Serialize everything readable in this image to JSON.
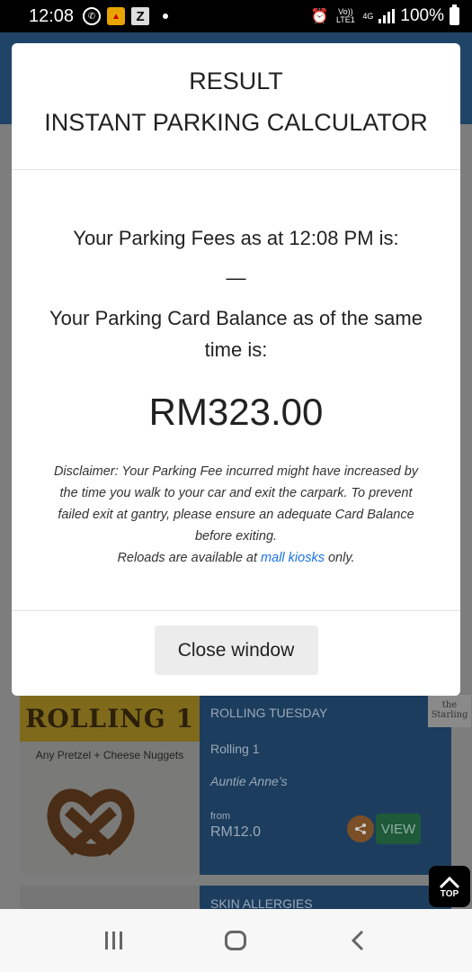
{
  "status_bar": {
    "time": "12:08",
    "volte": "Vo)) LTE1",
    "network": "4G",
    "battery": "100%"
  },
  "modal": {
    "title_line1": "RESULT",
    "title_line2": "INSTANT PARKING CALCULATOR",
    "fees_text": "Your Parking Fees as at 12:08 PM is:",
    "fees_value": "—",
    "balance_text": "Your Parking Card Balance as of the same time is:",
    "balance_amount": "RM323.00",
    "disclaimer": "Disclaimer: Your Parking Fee incurred might have increased by the time you walk to your car and exit the carpark. To prevent failed exit at gantry, please ensure an adequate Card Balance before exiting.",
    "reload_prefix": "Reloads are available at",
    "reload_link": "mall kiosks",
    "reload_suffix": "only.",
    "close_button": "Close window"
  },
  "background": {
    "deal1": {
      "banner": "ROLLING 1",
      "subtitle": "Any Pretzel + Cheese Nuggets",
      "category": "ROLLING TUESDAY",
      "name": "Rolling 1",
      "brand": "Auntie Anne’s",
      "from_label": "from",
      "price": "RM12.0",
      "view_button": "VIEW",
      "logo": "the Starling"
    },
    "deal2": {
      "category": "SKIN ALLERGIES"
    },
    "top_button": "TOP"
  }
}
